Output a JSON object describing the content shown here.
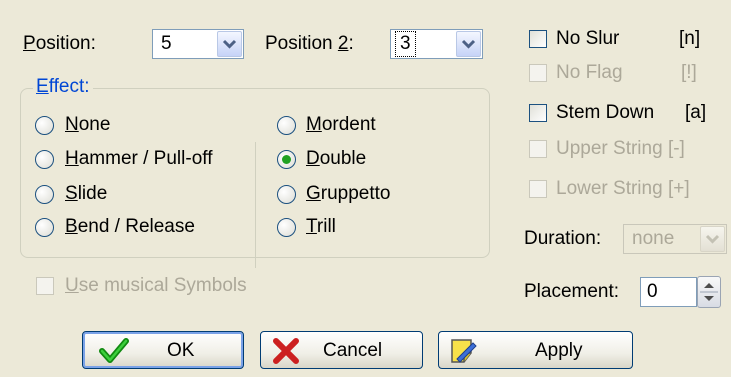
{
  "position": {
    "label_key": "P",
    "label_rest": "osition:",
    "value": "5"
  },
  "position2": {
    "label_pre": "Position ",
    "label_key": "2",
    "label_post": ":",
    "value": "3"
  },
  "effect": {
    "legend_key": "E",
    "legend_rest": "ffect:",
    "options": [
      {
        "key": "N",
        "rest": "one",
        "checked": false
      },
      {
        "key": "H",
        "rest": "ammer / Pull-off",
        "checked": false
      },
      {
        "key": "S",
        "rest": "lide",
        "checked": false
      },
      {
        "key": "B",
        "rest": "end / Release",
        "checked": false
      },
      {
        "key": "M",
        "rest": "ordent",
        "checked": false
      },
      {
        "key": "D",
        "rest": "ouble",
        "checked": true
      },
      {
        "key": "G",
        "rest": "ruppetto",
        "checked": false
      },
      {
        "key": "T",
        "rest": "rill",
        "checked": false
      }
    ]
  },
  "use_symbols": {
    "key": "U",
    "rest": "se musical Symbols"
  },
  "checkboxes": [
    {
      "label": "No Slur",
      "shortcut": "[n]",
      "enabled": true
    },
    {
      "label": "No Flag",
      "shortcut": "[!]",
      "enabled": false
    },
    {
      "label": "Stem Down",
      "shortcut": "[a]",
      "enabled": true
    },
    {
      "label": "Upper String [-]",
      "shortcut": "",
      "enabled": false
    },
    {
      "label": "Lower String [+]",
      "shortcut": "",
      "enabled": false
    }
  ],
  "duration": {
    "label": "Duration:",
    "value": "none"
  },
  "placement": {
    "label": "Placement:",
    "value": "0"
  },
  "buttons": {
    "ok": "OK",
    "cancel": "Cancel",
    "apply": "Apply"
  },
  "icons": {
    "ok": "checkmark-icon",
    "cancel": "x-icon",
    "apply": "note-pencil-icon",
    "dropdown": "chevron-down-icon",
    "spinner": "up-down-arrows-icon"
  },
  "colors": {
    "background": "#ece9d8",
    "legend": "#0046d5",
    "checkmark": "#21a121",
    "cancel_x": "#cc2020",
    "border": "#7f9db9"
  }
}
